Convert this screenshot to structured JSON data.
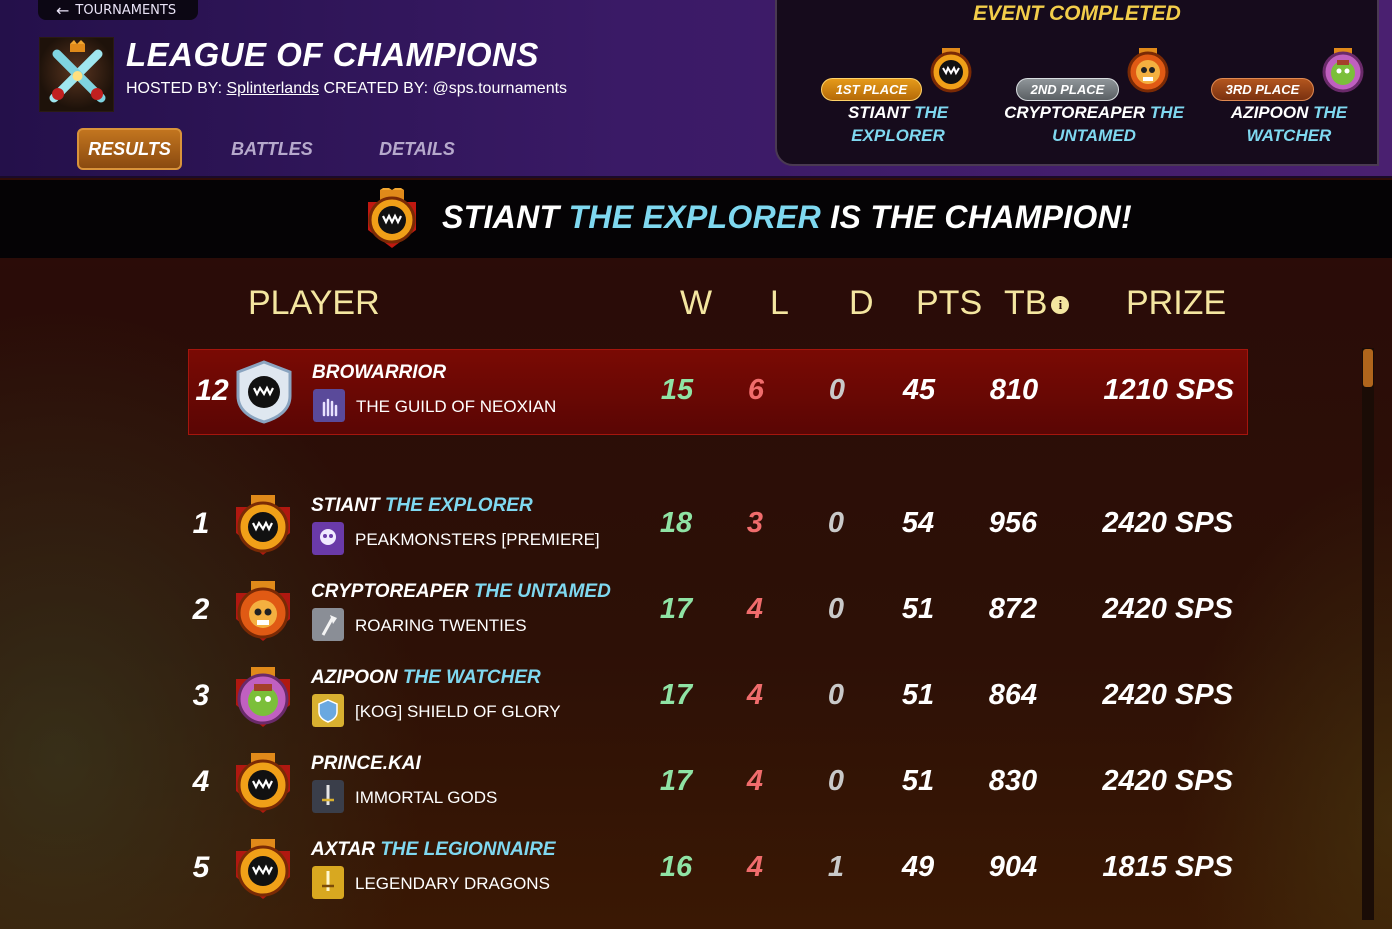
{
  "nav": {
    "back_label": "TOURNAMENTS"
  },
  "tournament": {
    "title": "LEAGUE OF CHAMPIONS",
    "hosted_by_label": "HOSTED BY:",
    "host": "Splinterlands",
    "created_by_label": "CREATED BY:",
    "creator": "@sps.tournaments"
  },
  "tabs": [
    {
      "label": "RESULTS",
      "active": true
    },
    {
      "label": "BATTLES",
      "active": false
    },
    {
      "label": "DETAILS",
      "active": false
    }
  ],
  "event": {
    "title": "EVENT COMPLETED",
    "places": [
      {
        "badge": "1ST PLACE",
        "name": "STIANT",
        "title": "THE EXPLORER",
        "avatar_icon": "fanged-crest-icon"
      },
      {
        "badge": "2ND PLACE",
        "name": "CRYPTOREAPER",
        "title": "THE UNTAMED",
        "avatar_icon": "flaming-skull-icon"
      },
      {
        "badge": "3RD PLACE",
        "name": "AZIPOON",
        "title": "THE WATCHER",
        "avatar_icon": "goblin-face-icon"
      }
    ]
  },
  "banner": {
    "name": "STIANT",
    "title": "THE EXPLORER",
    "suffix": "IS THE CHAMPION!"
  },
  "table": {
    "headers": {
      "player": "PLAYER",
      "w": "W",
      "l": "L",
      "d": "D",
      "pts": "PTS",
      "tb": "TB",
      "prize": "PRIZE"
    },
    "current_player": {
      "rank": "12",
      "name": "BROWARRIOR",
      "title": "",
      "guild": "THE GUILD OF NEOXIAN",
      "w": "15",
      "l": "6",
      "d": "0",
      "pts": "45",
      "tb": "810",
      "prize": "1210 SPS"
    },
    "rows": [
      {
        "rank": "1",
        "name": "STIANT",
        "title": "THE EXPLORER",
        "guild": "PEAKMONSTERS [PREMIERE]",
        "w": "18",
        "l": "3",
        "d": "0",
        "pts": "54",
        "tb": "956",
        "prize": "2420 SPS"
      },
      {
        "rank": "2",
        "name": "CRYPTOREAPER",
        "title": "THE UNTAMED",
        "guild": "ROARING TWENTIES",
        "w": "17",
        "l": "4",
        "d": "0",
        "pts": "51",
        "tb": "872",
        "prize": "2420 SPS"
      },
      {
        "rank": "3",
        "name": "AZIPOON",
        "title": "THE WATCHER",
        "guild": "[KOG] SHIELD OF GLORY",
        "w": "17",
        "l": "4",
        "d": "0",
        "pts": "51",
        "tb": "864",
        "prize": "2420 SPS"
      },
      {
        "rank": "4",
        "name": "PRINCE.KAI",
        "title": "",
        "guild": "IMMORTAL GODS",
        "w": "17",
        "l": "4",
        "d": "0",
        "pts": "51",
        "tb": "830",
        "prize": "2420 SPS"
      },
      {
        "rank": "5",
        "name": "AXTAR",
        "title": "THE LEGIONNAIRE",
        "guild": "LEGENDARY DRAGONS",
        "w": "16",
        "l": "4",
        "d": "1",
        "pts": "49",
        "tb": "904",
        "prize": "1815 SPS"
      }
    ]
  },
  "colors": {
    "header_purple": "#3a1a66",
    "accent_orange": "#c2751f",
    "title_cyan": "#7fd8f0",
    "win_green": "#8fe3a4",
    "loss_red": "#f06c6c",
    "header_gold": "#f4e6a0",
    "highlight_red": "#7a0a04"
  }
}
